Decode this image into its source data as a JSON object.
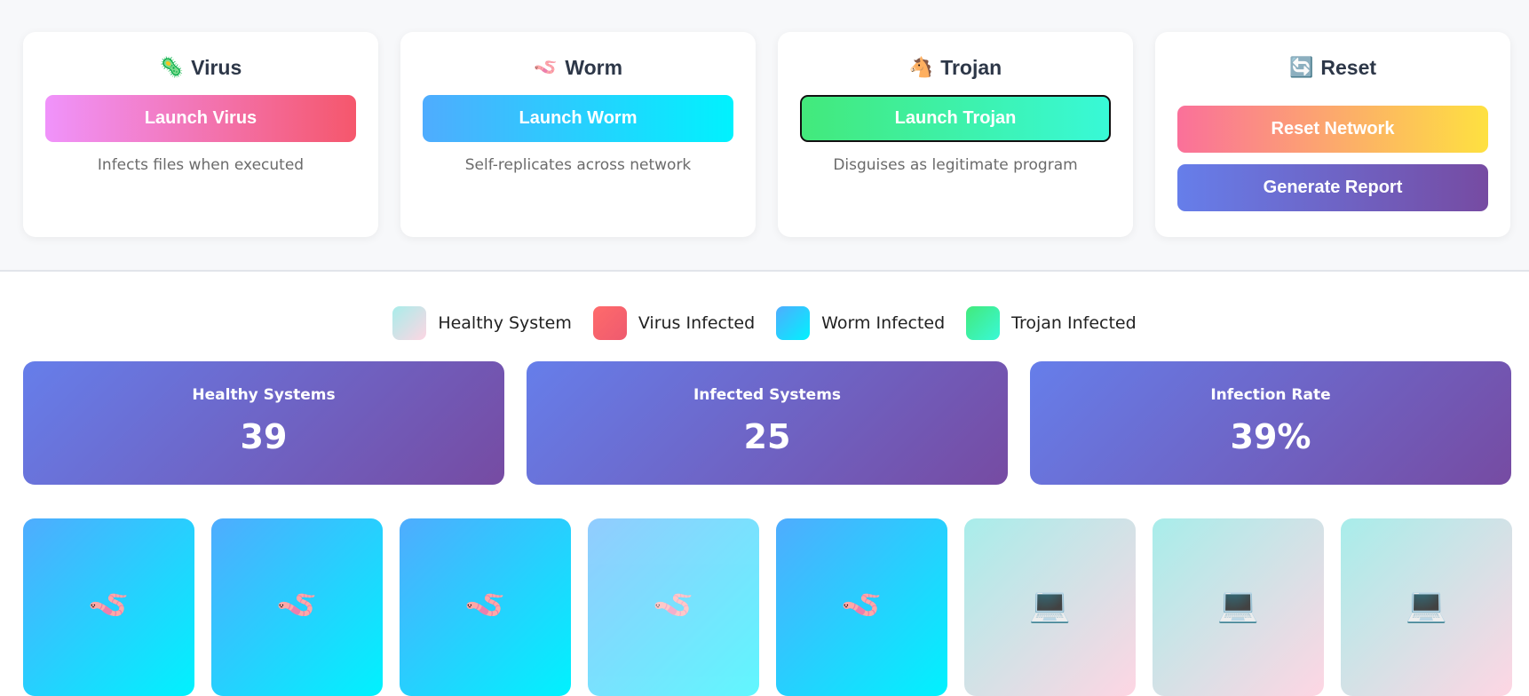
{
  "attacks": [
    {
      "icon": "🦠",
      "icon_name": "virus-icon",
      "title": "Virus",
      "button": "Launch Virus",
      "description": "Infects files when executed"
    },
    {
      "icon": "🪱",
      "icon_name": "worm-icon",
      "title": "Worm",
      "button": "Launch Worm",
      "description": "Self-replicates across network"
    },
    {
      "icon": "🐴",
      "icon_name": "horse-icon",
      "title": "Trojan",
      "button": "Launch Trojan",
      "description": "Disguises as legitimate program"
    }
  ],
  "reset_card": {
    "icon": "🔄",
    "icon_name": "refresh-icon",
    "title": "Reset",
    "reset_button": "Reset Network",
    "report_button": "Generate Report"
  },
  "legend": [
    {
      "label": "Healthy System",
      "color": "#a8edea"
    },
    {
      "label": "Virus Infected",
      "color": "#ff6b6b"
    },
    {
      "label": "Worm Infected",
      "color": "#4facfe"
    },
    {
      "label": "Trojan Infected",
      "color": "#43e97b"
    }
  ],
  "stats": [
    {
      "label": "Healthy Systems",
      "value": "39"
    },
    {
      "label": "Infected Systems",
      "value": "25"
    },
    {
      "label": "Infection Rate",
      "value": "39%"
    }
  ],
  "nodes": [
    {
      "state": "worm",
      "icon": "🪱",
      "icon_name": "worm-icon"
    },
    {
      "state": "worm",
      "icon": "🪱",
      "icon_name": "worm-icon"
    },
    {
      "state": "worm",
      "icon": "🪱",
      "icon_name": "worm-icon"
    },
    {
      "state": "worm-faded",
      "icon": "🪱",
      "icon_name": "worm-icon"
    },
    {
      "state": "worm",
      "icon": "🪱",
      "icon_name": "worm-icon"
    },
    {
      "state": "healthy",
      "icon": "💻",
      "icon_name": "laptop-icon"
    },
    {
      "state": "healthy",
      "icon": "💻",
      "icon_name": "laptop-icon"
    },
    {
      "state": "healthy",
      "icon": "💻",
      "icon_name": "laptop-icon"
    }
  ]
}
